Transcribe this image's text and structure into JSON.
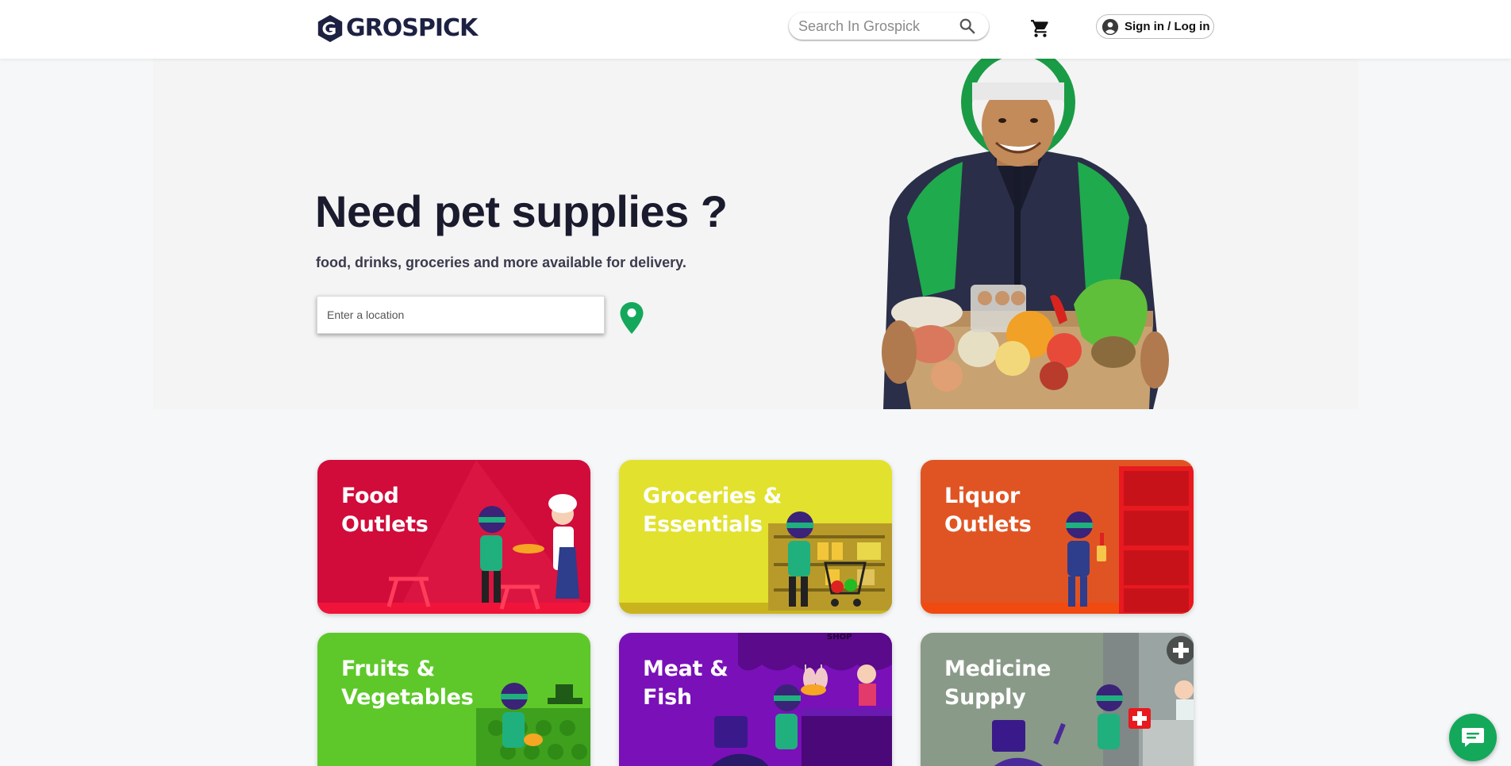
{
  "header": {
    "logo_text": "GROSPICK",
    "search": {
      "placeholder": "Search In Grospick",
      "value": ""
    },
    "signin_label": "Sign in / Log in"
  },
  "hero": {
    "title": "Need pet supplies ?",
    "subtitle": "food, drinks, groceries and more available for delivery.",
    "location": {
      "placeholder": "Enter a location",
      "value": ""
    }
  },
  "categories": [
    {
      "label": "Food\nOutlets",
      "color": "#d10b3a"
    },
    {
      "label": "Groceries &\nEssentials",
      "color": "#e2e12e"
    },
    {
      "label": "Liquor\nOutlets",
      "color": "#e05423"
    },
    {
      "label": "Fruits &\nVegetables",
      "color": "#5ec82a"
    },
    {
      "label": "Meat &\nFish",
      "color": "#7a10b8"
    },
    {
      "label": "Medicine\nSupply",
      "color": "#8a9a88"
    }
  ],
  "colors": {
    "brand_navy": "#1d2142",
    "brand_green": "#14a85a",
    "page_bg": "#f5f7f8",
    "hero_bg": "#f4f4f4"
  },
  "icons": [
    "search-icon",
    "cart-icon",
    "user-icon",
    "location-pin-icon",
    "chat-icon"
  ]
}
